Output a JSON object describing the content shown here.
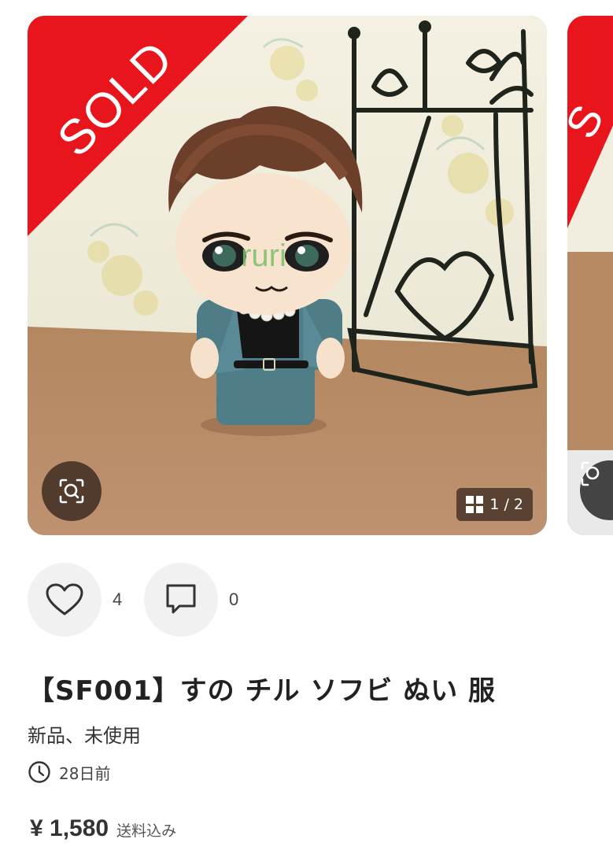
{
  "listing": {
    "sold_badge": "SOLD",
    "watermark": "ruri",
    "image_counter": "1 / 2",
    "likes_count": "4",
    "comments_count": "0",
    "title": "【SF001】すの チル ソフビ ぬい 服",
    "condition": "新品、未使用",
    "posted": "28日前",
    "price": "¥ 1,580",
    "shipping": "送料込み"
  },
  "next_card": {
    "sold_badge": "S"
  },
  "icons": {
    "lens": "image-search-icon",
    "gallery": "grid-icon",
    "like": "heart-icon",
    "comment": "comment-icon",
    "time": "clock-icon"
  },
  "colors": {
    "sold_red": "#e8161c",
    "overlay_brown": "#4a3628"
  }
}
